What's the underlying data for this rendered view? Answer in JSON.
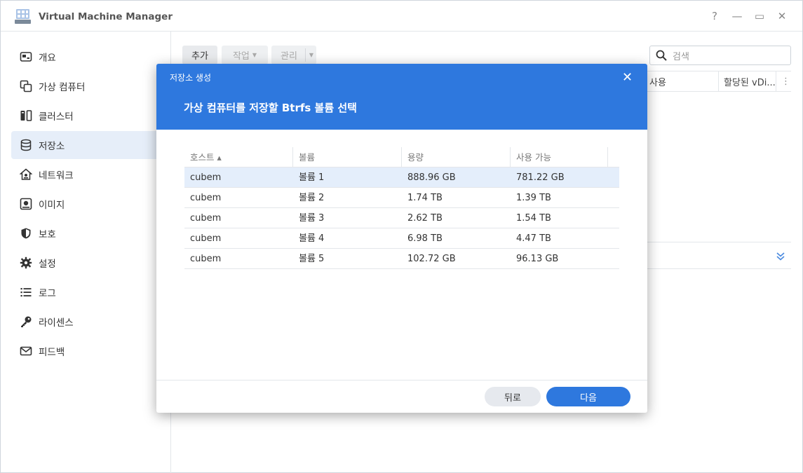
{
  "window": {
    "title": "Virtual Machine Manager",
    "controls": {
      "help": "?",
      "minimize": "—",
      "maximize": "▭",
      "close": "✕"
    }
  },
  "sidebar": {
    "items": [
      {
        "label": "개요",
        "icon": "overview-icon"
      },
      {
        "label": "가상 컴퓨터",
        "icon": "virtual-machine-icon"
      },
      {
        "label": "클러스터",
        "icon": "cluster-icon"
      },
      {
        "label": "저장소",
        "icon": "storage-icon",
        "active": true
      },
      {
        "label": "네트워크",
        "icon": "network-icon"
      },
      {
        "label": "이미지",
        "icon": "image-icon"
      },
      {
        "label": "보호",
        "icon": "shield-icon"
      },
      {
        "label": "설정",
        "icon": "gear-icon"
      },
      {
        "label": "로그",
        "icon": "log-list-icon"
      },
      {
        "label": "라이센스",
        "icon": "key-icon"
      },
      {
        "label": "피드백",
        "icon": "mail-icon"
      }
    ]
  },
  "toolbar": {
    "add_label": "추가",
    "action_label": "작업",
    "manage_label": "관리"
  },
  "search": {
    "placeholder": "검색"
  },
  "background_table": {
    "headers": [
      "사용",
      "할당된 vDi..."
    ]
  },
  "dialog": {
    "small_title": "저장소 생성",
    "title": "가상 컴퓨터를 저장할 Btrfs 볼륨 선택",
    "close": "✕",
    "table": {
      "headers": [
        "호스트 ▴",
        "볼륨",
        "용량",
        "사용 가능"
      ],
      "rows": [
        [
          "cubem",
          "볼륨 1",
          "888.96 GB",
          "781.22 GB"
        ],
        [
          "cubem",
          "볼륨 2",
          "1.74 TB",
          "1.39 TB"
        ],
        [
          "cubem",
          "볼륨 3",
          "2.62 TB",
          "1.54 TB"
        ],
        [
          "cubem",
          "볼륨 4",
          "6.98 TB",
          "4.47 TB"
        ],
        [
          "cubem",
          "볼륨 5",
          "102.72 GB",
          "96.13 GB"
        ]
      ],
      "selected_row": 0
    },
    "back_label": "뒤로",
    "next_label": "다음"
  },
  "colors": {
    "accent": "#2e78de",
    "selected_row": "#e4eefb",
    "sidebar_active": "#e6eef9"
  }
}
